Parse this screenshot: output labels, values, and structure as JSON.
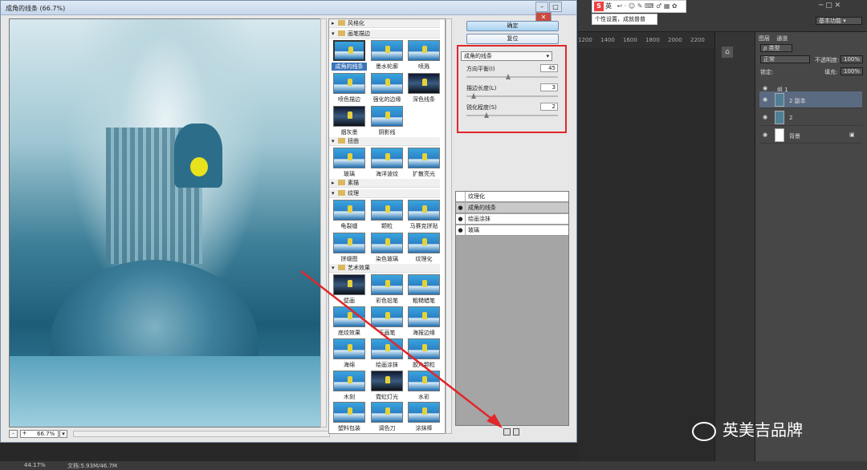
{
  "dialog": {
    "title": "成角的线条 (66.7%)",
    "zoom": "66.7%",
    "zoom_minus": "-",
    "zoom_plus": "+",
    "ok": "确定",
    "reset": "复位",
    "filter_select": "成角的线条",
    "params": [
      {
        "label": "方向平衡(I)",
        "value": "45",
        "fraction": 0.45
      },
      {
        "label": "描边长度(L)",
        "value": "3",
        "fraction": 0.06
      },
      {
        "label": "锐化程度(S)",
        "value": "2",
        "fraction": 0.2
      }
    ],
    "effect_layers": [
      {
        "name": "纹理化",
        "visible": false,
        "selected": false
      },
      {
        "name": "成角的线条",
        "visible": true,
        "selected": true
      },
      {
        "name": "绘画涂抹",
        "visible": true,
        "selected": false
      },
      {
        "name": "玻璃",
        "visible": true,
        "selected": false
      }
    ]
  },
  "gallery": {
    "categories": [
      {
        "name": "风格化",
        "expanded": false,
        "items": []
      },
      {
        "name": "画笔描边",
        "expanded": true,
        "items": [
          "成角的线条",
          "墨水轮廓",
          "喷溅",
          "喷色描边",
          "强化的边缘",
          "深色线条",
          "烟灰墨",
          "阴影线"
        ]
      },
      {
        "name": "扭曲",
        "expanded": true,
        "items": [
          "玻璃",
          "海洋波纹",
          "扩散亮光"
        ]
      },
      {
        "name": "素描",
        "expanded": false,
        "items": []
      },
      {
        "name": "纹理",
        "expanded": true,
        "items": [
          "龟裂缝",
          "颗粒",
          "马赛克拼贴",
          "拼缀图",
          "染色玻璃",
          "纹理化"
        ]
      },
      {
        "name": "艺术效果",
        "expanded": true,
        "items": [
          "壁画",
          "彩色铅笔",
          "粗糙蜡笔",
          "底纹效果",
          "干画笔",
          "海报边缘",
          "海绵",
          "绘画涂抹",
          "胶片颗粒",
          "木刻",
          "霓虹灯光",
          "水彩",
          "塑料包装",
          "调色刀",
          "涂抹棒"
        ]
      }
    ]
  },
  "photoshop": {
    "workspace": "基本功能",
    "ruler_ticks": [
      "1200",
      "1400",
      "1600",
      "1800",
      "2000",
      "2200"
    ],
    "panel_tabs": [
      "图层",
      "通道"
    ],
    "kind_label": "ρ 类型",
    "blend_mode": "正常",
    "opacity_label": "不透明度:",
    "opacity": "100%",
    "lock_label": "锁定:",
    "fill_label": "填充:",
    "fill": "100%",
    "layers": [
      {
        "name": "组 1",
        "type": "group"
      },
      {
        "name": "2 副本",
        "type": "smart",
        "selected": true
      },
      {
        "name": "2",
        "type": "layer"
      },
      {
        "name": "背景",
        "type": "background"
      }
    ],
    "status_zoom": "44.17%",
    "status_doc": "文档:5.93M/46.7M"
  },
  "sogou": {
    "label": "英",
    "tip": "个性设置，成就普普"
  },
  "watermark": "英美吉品牌",
  "annotation": {
    "color": "#e0272b"
  }
}
